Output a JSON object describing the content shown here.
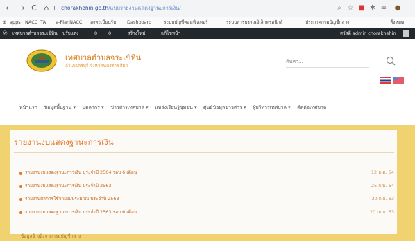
{
  "browser": {
    "back": "←",
    "forward": "→",
    "reload": "C",
    "home": "⌂",
    "url_domain": "chorakhehin.go.th",
    "url_path": "/แบบรายงานแสดงฐานะการเงิน/",
    "bookmarks": [
      "apps",
      "NACC ITA",
      "e-PlanNACC",
      "ลงทะเบียนรับ",
      "Dashboard",
      "ระบบบัญชีคอมพิวเตอร์",
      "ระบบสารบรรณอิเล็กทรอนิกส์",
      "ประกาศกรมบัญชีกลาง",
      "ทั้งหมด"
    ]
  },
  "adminbar": {
    "items": [
      "เทศบาลตำบลจระเข้หิน",
      "ปรับแต่ง",
      "0",
      "0",
      "+ สร้างใหม่",
      "แก้ไขหน้า"
    ],
    "user": "สวัสดี admin chorakhehin"
  },
  "site": {
    "title": "เทศบาลตำบลจระเข้หิน",
    "subtitle": "อำเภอครบุรี จังหวัดนครราชสีมา",
    "search_placeholder": "ค้นหา..."
  },
  "nav": [
    "หน้าแรก",
    "ข้อมูลพื้นฐาน ▾",
    "บุคลากร ▾",
    "ข่าวสารเทศบาล ▾",
    "แหล่งเรียนรู้ชุมชน ▾",
    "ศูนย์ข้อมูลข่าวสาร ▾",
    "ผู้บริหารเทศบาล ▾",
    "ติดต่อเทศบาล"
  ],
  "section": {
    "title": "รายงานงบแสดงฐานะการเงิน",
    "rows": [
      {
        "title": "รายงานงบแสดงฐานะการเงิน ประจำปี 2564 รอบ 6 เดือน",
        "date": "12 ธ.ค. 64"
      },
      {
        "title": "รายงานงบแสดงฐานะการเงิน ประจำปี 2563",
        "date": "25 ก.พ. 64"
      },
      {
        "title": "รายงานผลการใช้จ่ายงบประมาณ ประจำปี 2563",
        "date": "30 ก.ย. 63"
      },
      {
        "title": "รายงานงบแสดงฐานะการเงิน ประจำปี 2563 รอบ 6 เดือน",
        "date": "20 เม.ย. 63"
      }
    ]
  },
  "footer": "ข้อมูลอ้างอิงจากกรมบัญชีกลาง",
  "colors": {
    "accent": "#e4782a",
    "band": "#f1d271",
    "adminbar": "#23282d"
  }
}
